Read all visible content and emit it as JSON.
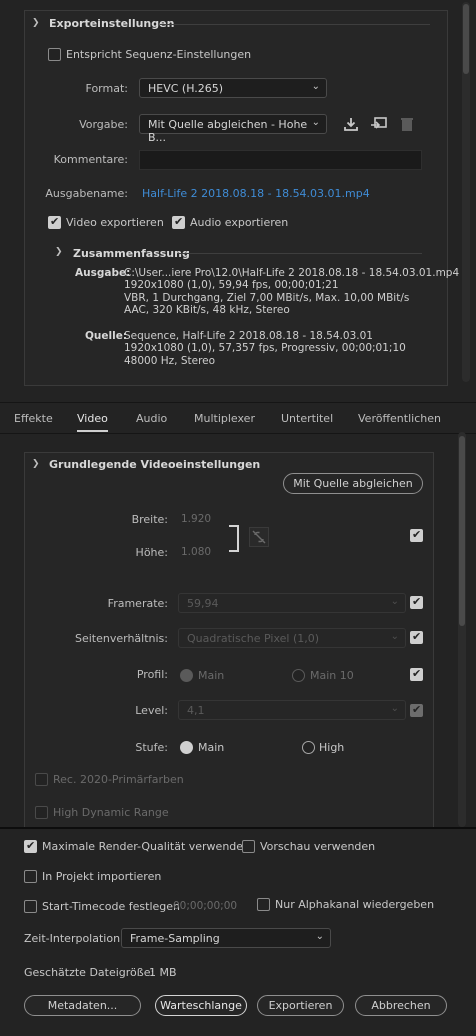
{
  "export_settings": {
    "title": "Exporteinstellungen",
    "match_sequence_label": "Entspricht Sequenz-Einstellungen",
    "format_label": "Format:",
    "format_value": "HEVC (H.265)",
    "preset_label": "Vorgabe:",
    "preset_value": "Mit Quelle abgleichen - Hohe B...",
    "comments_label": "Kommentare:",
    "comments_value": "",
    "output_name_label": "Ausgabename:",
    "output_name_value": "Half-Life 2 2018.08.18 - 18.54.03.01.mp4",
    "export_video_label": "Video exportieren",
    "export_audio_label": "Audio exportieren",
    "summary": {
      "title": "Zusammenfassung",
      "output_label": "Ausgabe:",
      "output_lines": [
        "C:\\User...iere Pro\\12.0\\Half-Life 2 2018.08.18 - 18.54.03.01.mp4",
        "1920x1080 (1,0), 59,94 fps, 00;00;01;21",
        "VBR, 1 Durchgang, Ziel 7,00 MBit/s, Max. 10,00 MBit/s",
        "AAC, 320 KBit/s, 48 kHz, Stereo"
      ],
      "source_label": "Quelle:",
      "source_lines": [
        "Sequence, Half-Life 2 2018.08.18 - 18.54.03.01",
        "1920x1080 (1,0), 57,357 fps, Progressiv, 00;00;01;10",
        "48000 Hz, Stereo"
      ]
    }
  },
  "tabs": [
    {
      "label": "Effekte",
      "active": false
    },
    {
      "label": "Video",
      "active": true
    },
    {
      "label": "Audio",
      "active": false
    },
    {
      "label": "Multiplexer",
      "active": false
    },
    {
      "label": "Untertitel",
      "active": false
    },
    {
      "label": "Veröffentlichen",
      "active": false
    }
  ],
  "video_basic": {
    "title": "Grundlegende Videoeinstellungen",
    "match_source_button": "Mit Quelle abgleichen",
    "width_label": "Breite:",
    "width_value": "1.920",
    "height_label": "Höhe:",
    "height_value": "1.080",
    "framerate_label": "Framerate:",
    "framerate_value": "59,94",
    "aspect_label": "Seitenverhältnis:",
    "aspect_value": "Quadratische Pixel (1,0)",
    "profile_label": "Profil:",
    "profile_main": "Main",
    "profile_main10": "Main 10",
    "level_label": "Level:",
    "level_value": "4,1",
    "tier_label": "Stufe:",
    "tier_main": "Main",
    "tier_high": "High",
    "rec2020_label": "Rec. 2020-Primärfarben",
    "hdr_label": "High Dynamic Range"
  },
  "bottom": {
    "max_render_label": "Maximale Render-Qualität verwenden",
    "use_preview_label": "Vorschau verwenden",
    "import_project_label": "In Projekt importieren",
    "start_timecode_label": "Start-Timecode festlegen",
    "start_timecode_value": "00;00;00;00",
    "alpha_only_label": "Nur Alphakanal wiedergeben",
    "time_interp_label": "Zeit-Interpolation:",
    "time_interp_value": "Frame-Sampling",
    "file_size_label": "Geschätzte Dateigröße:",
    "file_size_value": "1 MB",
    "metadata_button": "Metadaten...",
    "queue_button": "Warteschlange",
    "export_button": "Exportieren",
    "cancel_button": "Abbrechen"
  },
  "colors": {
    "link": "#3f8cd6",
    "background": "#232323"
  }
}
